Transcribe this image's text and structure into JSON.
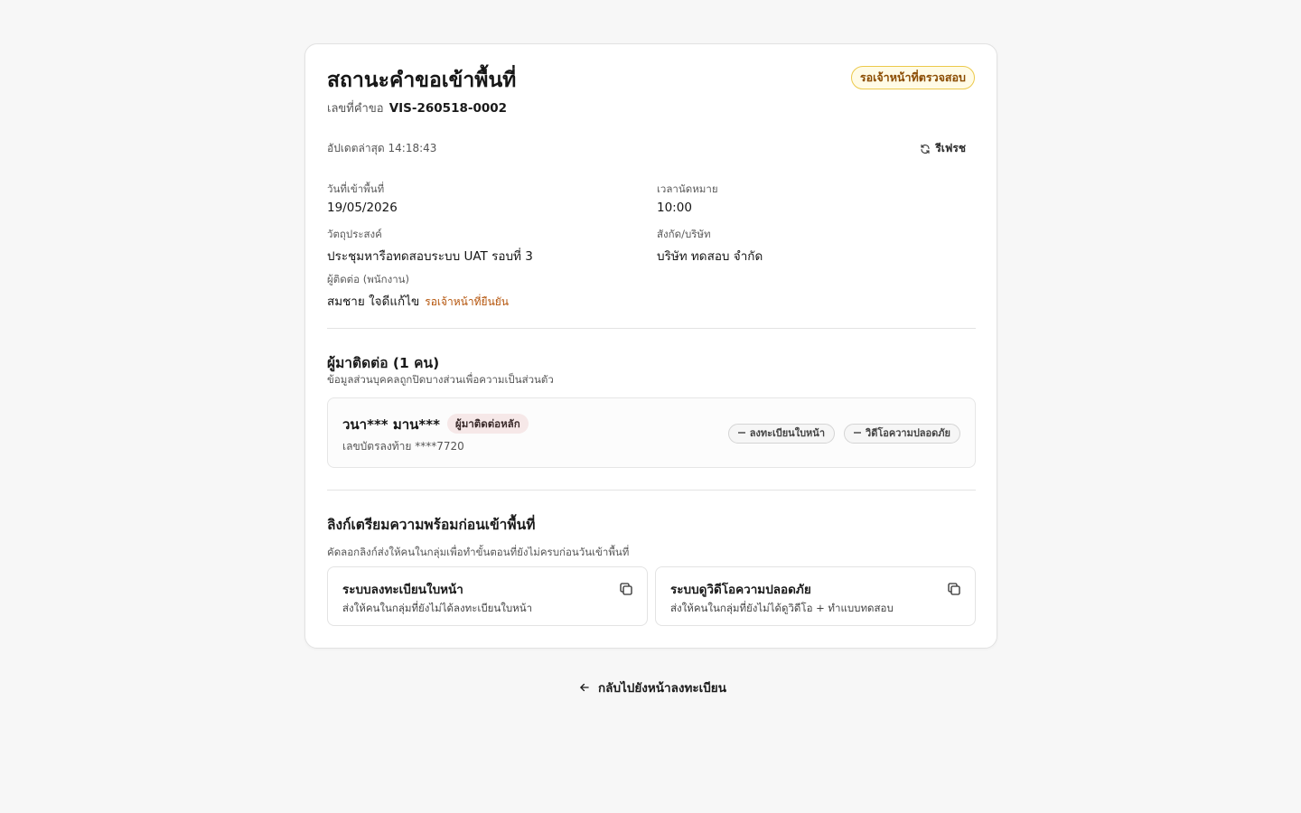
{
  "header": {
    "title": "สถานะคำขอเข้าพื้นที่",
    "request_label": "เลขที่คำขอ",
    "request_no": "VIS-260518-0002",
    "status_badge": "รอเจ้าหน้าที่ตรวจสอบ",
    "updated_text": "อัปเดตล่าสุด 14:18:43",
    "refresh_label": "รีเฟรช"
  },
  "fields": {
    "visit_date_label": "วันที่เข้าพื้นที่",
    "visit_date": "19/05/2026",
    "time_label": "เวลานัดหมาย",
    "time": "10:00",
    "purpose_label": "วัตถุประสงค์",
    "purpose": "ประชุมหารือทดสอบระบบ UAT รอบที่ 3",
    "company_label": "สังกัด/บริษัท",
    "company": "บริษัท ทดสอบ จำกัด",
    "contact_label": "ผู้ติดต่อ (พนักงาน)",
    "contact": "สมชาย ใจดีแก้ไข",
    "contact_status": "รอเจ้าหน้าที่ยืนยัน"
  },
  "visitors": {
    "title": "ผู้มาติดต่อ (1 คน)",
    "subtitle": "ข้อมูลส่วนบุคคลถูกปิดบางส่วนเพื่อความเป็นส่วนตัว",
    "items": [
      {
        "name": "วนา*** มาน***",
        "tag": "ผู้มาติดต่อหลัก",
        "id_text": "เลขบัตรลงท้าย ****7720",
        "chips": [
          "ลงทะเบียนใบหน้า",
          "วิดีโอความปลอดภัย"
        ]
      }
    ]
  },
  "links": {
    "title": "ลิงก์เตรียมความพร้อมก่อนเข้าพื้นที่",
    "subtitle": "คัดลอกลิงก์ส่งให้คนในกลุ่มเพื่อทำขั้นตอนที่ยังไม่ครบก่อนวันเข้าพื้นที่",
    "cards": [
      {
        "title": "ระบบลงทะเบียนใบหน้า",
        "desc": "ส่งให้คนในกลุ่มที่ยังไม่ได้ลงทะเบียนใบหน้า",
        "icon": "copy-icon"
      },
      {
        "title": "ระบบดูวิดีโอความปลอดภัย",
        "desc": "ส่งให้คนในกลุ่มที่ยังไม่ได้ดูวิดีโอ + ทำแบบทดสอบ",
        "icon": "copy-icon"
      }
    ]
  },
  "footer": {
    "back_label": "กลับไปยังหน้าลงทะเบียน",
    "back_icon": "arrow-left-icon"
  },
  "colors": {
    "badge_border": "#ecc94b",
    "badge_bg": "#fffbe6",
    "badge_text": "#8a4b00",
    "pending_text": "#b45309"
  }
}
